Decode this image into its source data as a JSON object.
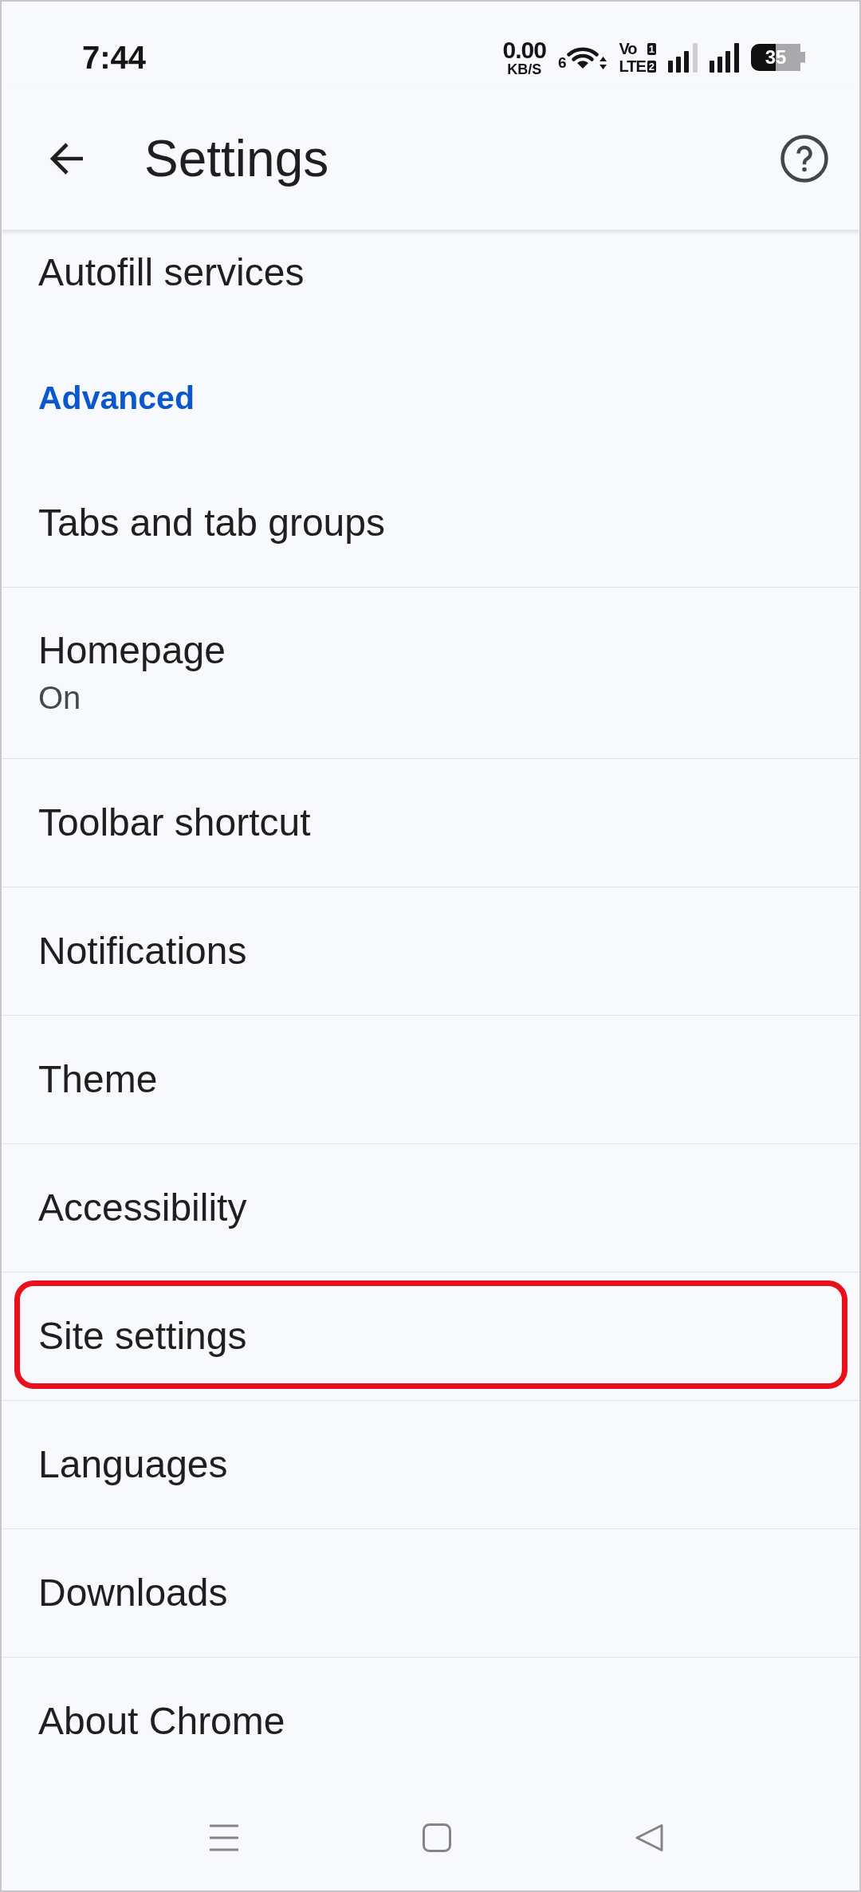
{
  "status_bar": {
    "time": "7:44",
    "speed_value": "0.00",
    "speed_unit": "KB/S",
    "wifi_badge": "6",
    "network": [
      {
        "label": "Vo",
        "sim": "1"
      },
      {
        "label": "LTE",
        "sim": "2"
      }
    ],
    "battery": "35"
  },
  "app_bar": {
    "title": "Settings"
  },
  "items": [
    {
      "kind": "entry",
      "title": "Autofill services",
      "highlighted": false
    },
    {
      "kind": "section",
      "title": "Advanced"
    },
    {
      "kind": "entry",
      "title": "Tabs and tab groups",
      "highlighted": false
    },
    {
      "kind": "entry",
      "title": "Homepage",
      "subtitle": "On",
      "highlighted": false
    },
    {
      "kind": "entry",
      "title": "Toolbar shortcut",
      "highlighted": false
    },
    {
      "kind": "entry",
      "title": "Notifications",
      "highlighted": false
    },
    {
      "kind": "entry",
      "title": "Theme",
      "highlighted": false
    },
    {
      "kind": "entry",
      "title": "Accessibility",
      "highlighted": false
    },
    {
      "kind": "entry",
      "title": "Site settings",
      "highlighted": true
    },
    {
      "kind": "entry",
      "title": "Languages",
      "highlighted": false
    },
    {
      "kind": "entry",
      "title": "Downloads",
      "highlighted": false
    },
    {
      "kind": "entry",
      "title": "About Chrome",
      "highlighted": false
    }
  ]
}
